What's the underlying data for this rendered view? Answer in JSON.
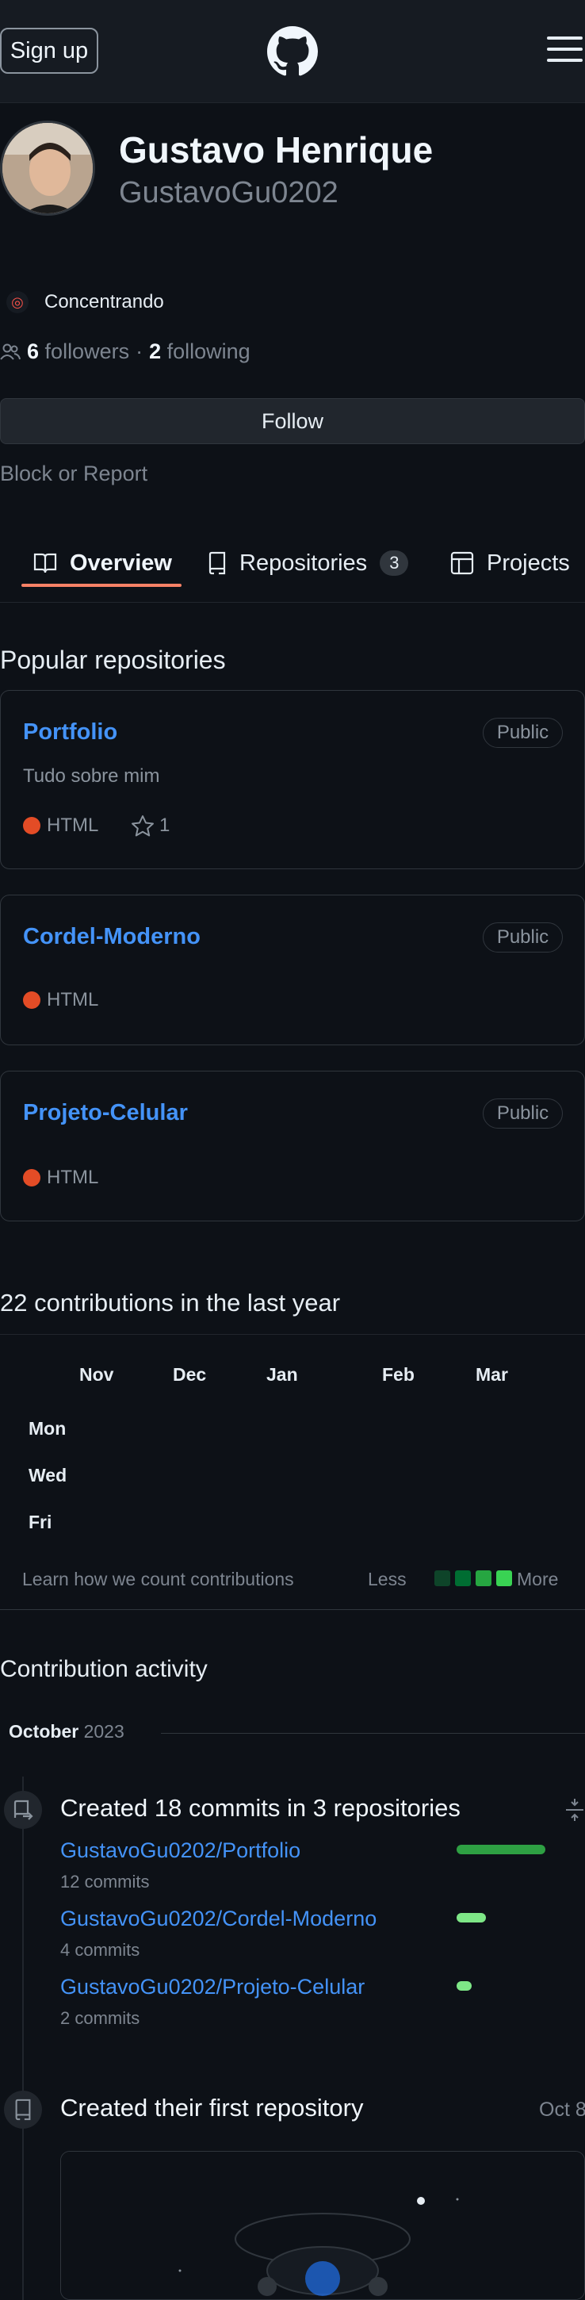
{
  "header": {
    "signup_label": "Sign up",
    "logo_icon": "github-octocat-icon",
    "menu_icon": "hamburger-menu-icon"
  },
  "profile": {
    "name": "Gustavo Henrique",
    "login": "GustavoGu0202",
    "status_emoji": "dart-icon",
    "status_text": "Concentrando",
    "followers_count": "6",
    "followers_label": "followers",
    "separator": "·",
    "following_count": "2",
    "following_label": "following",
    "follow_button": "Follow",
    "block_link": "Block or Report"
  },
  "tabs": [
    {
      "label": "Overview",
      "icon": "book-icon",
      "active": true
    },
    {
      "label": "Repositories",
      "icon": "repo-icon",
      "count": "3"
    },
    {
      "label": "Projects",
      "icon": "table-icon"
    }
  ],
  "popular": {
    "title": "Popular repositories",
    "repos": [
      {
        "name": "Portfolio",
        "visibility": "Public",
        "description": "Tudo sobre mim",
        "language": "HTML",
        "stars": "1"
      },
      {
        "name": "Cordel-Moderno",
        "visibility": "Public",
        "language": "HTML"
      },
      {
        "name": "Projeto-Celular",
        "visibility": "Public",
        "language": "HTML"
      }
    ]
  },
  "contributions": {
    "title": "22 contributions in the last year",
    "months": [
      "Nov",
      "Dec",
      "Jan",
      "Feb",
      "Mar"
    ],
    "weekdays": [
      "Mon",
      "Wed",
      "Fri"
    ],
    "learn_link": "Learn how we count contributions",
    "less": "Less",
    "more": "More",
    "legend_colors": [
      "#0e4429",
      "#006d32",
      "#26a641",
      "#39d353"
    ]
  },
  "activity": {
    "title": "Contribution activity",
    "month": "October",
    "year": "2023",
    "commits_title": "Created 18 commits in 3 repositories",
    "commit_repos": [
      {
        "repo": "GustavoGu0202/Portfolio",
        "commits": "12 commits",
        "share": 12
      },
      {
        "repo": "GustavoGu0202/Cordel-Moderno",
        "commits": "4 commits",
        "share": 4
      },
      {
        "repo": "GustavoGu0202/Projeto-Celular",
        "commits": "2 commits",
        "share": 2
      }
    ],
    "first_repo_title": "Created their first repository",
    "first_repo_date": "Oct 8"
  },
  "colors": {
    "background": "#0d1117",
    "link": "#4493f8",
    "tab_underline": "#f78166",
    "html_language": "#e34c26",
    "bar": "#2ea043"
  }
}
